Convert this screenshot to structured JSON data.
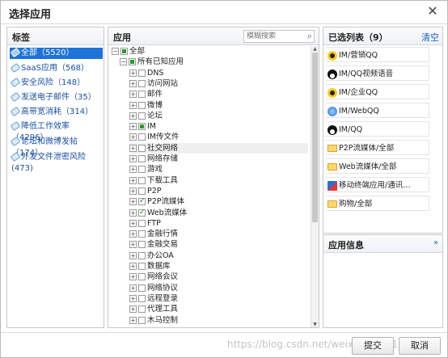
{
  "dialog": {
    "title": "选择应用",
    "close_symbol": "✕"
  },
  "left": {
    "header": "标签",
    "categories": [
      {
        "label": "全部（5520）",
        "active": true
      },
      {
        "label": "SaaS应用（568）",
        "active": false
      },
      {
        "label": "安全风险（148）",
        "active": false
      },
      {
        "label": "发送电子邮件（35）",
        "active": false
      },
      {
        "label": "高带宽消耗（314）",
        "active": false
      },
      {
        "label": "降低工作效率（4296）",
        "active": false
      },
      {
        "label": "论坛和微博发帖（174）",
        "active": false
      },
      {
        "label": "外发文件泄密风险",
        "label2": "(473)",
        "active": false
      }
    ]
  },
  "middle": {
    "header": "应用",
    "search_placeholder": "模糊搜索",
    "tree": [
      {
        "label": "全部",
        "level": 0,
        "check": "part",
        "toggle": "−"
      },
      {
        "label": "所有已知应用",
        "level": 1,
        "check": "part",
        "toggle": "−"
      },
      {
        "label": "DNS",
        "level": 2,
        "check": "none",
        "toggle": "+"
      },
      {
        "label": "访问网站",
        "level": 2,
        "check": "none",
        "toggle": "+"
      },
      {
        "label": "邮件",
        "level": 2,
        "check": "none",
        "toggle": "+"
      },
      {
        "label": "微博",
        "level": 2,
        "check": "none",
        "toggle": "+"
      },
      {
        "label": "论坛",
        "level": 2,
        "check": "none",
        "toggle": "+"
      },
      {
        "label": "IM",
        "level": 2,
        "check": "part",
        "toggle": "+"
      },
      {
        "label": "IM传文件",
        "level": 2,
        "check": "none",
        "toggle": "+"
      },
      {
        "label": "社交网络",
        "level": 2,
        "check": "none",
        "toggle": "+",
        "highlight": true
      },
      {
        "label": "网络存储",
        "level": 2,
        "check": "none",
        "toggle": "+"
      },
      {
        "label": "游戏",
        "level": 2,
        "check": "none",
        "toggle": "+"
      },
      {
        "label": "下载工具",
        "level": 2,
        "check": "none",
        "toggle": "+"
      },
      {
        "label": "P2P",
        "level": 2,
        "check": "none",
        "toggle": "+"
      },
      {
        "label": "P2P流媒体",
        "level": 2,
        "check": "checked",
        "toggle": "+"
      },
      {
        "label": "Web流媒体",
        "level": 2,
        "check": "checked",
        "toggle": "+"
      },
      {
        "label": "FTP",
        "level": 2,
        "check": "none",
        "toggle": "+"
      },
      {
        "label": "金融行情",
        "level": 2,
        "check": "none",
        "toggle": "+"
      },
      {
        "label": "金融交易",
        "level": 2,
        "check": "none",
        "toggle": "+"
      },
      {
        "label": "办公OA",
        "level": 2,
        "check": "none",
        "toggle": "+"
      },
      {
        "label": "数据库",
        "level": 2,
        "check": "none",
        "toggle": "+"
      },
      {
        "label": "网络会议",
        "level": 2,
        "check": "none",
        "toggle": "+"
      },
      {
        "label": "网络协议",
        "level": 2,
        "check": "none",
        "toggle": "+"
      },
      {
        "label": "远程登录",
        "level": 2,
        "check": "none",
        "toggle": "+"
      },
      {
        "label": "代理工具",
        "level": 2,
        "check": "none",
        "toggle": "+"
      },
      {
        "label": "木马控制",
        "level": 2,
        "check": "none",
        "toggle": "+"
      }
    ]
  },
  "selected": {
    "header": "已选列表（9）",
    "clear_label": "清空",
    "items": [
      {
        "label": "IM/营销QQ",
        "icon": "qq-icon"
      },
      {
        "label": "IM/QQ视频语音",
        "icon": "penguin-icon"
      },
      {
        "label": "IM/企业QQ",
        "icon": "qq-icon"
      },
      {
        "label": "IM/WebQQ",
        "icon": "globe-icon"
      },
      {
        "label": "IM/QQ",
        "icon": "penguin-icon"
      },
      {
        "label": "P2P流媒体/全部",
        "icon": "folder-icon"
      },
      {
        "label": "Web流媒体/全部",
        "icon": "folder-icon"
      },
      {
        "label": "移动终端应用/通讯…",
        "icon": "app-icon"
      },
      {
        "label": "购物/全部",
        "icon": "folder-icon"
      }
    ]
  },
  "info": {
    "header": "应用信息",
    "chevron": "»"
  },
  "footer": {
    "watermark": "https://blog.csdn.net/weixin_48751519",
    "ok_label": "提交",
    "cancel_label": "取消"
  }
}
